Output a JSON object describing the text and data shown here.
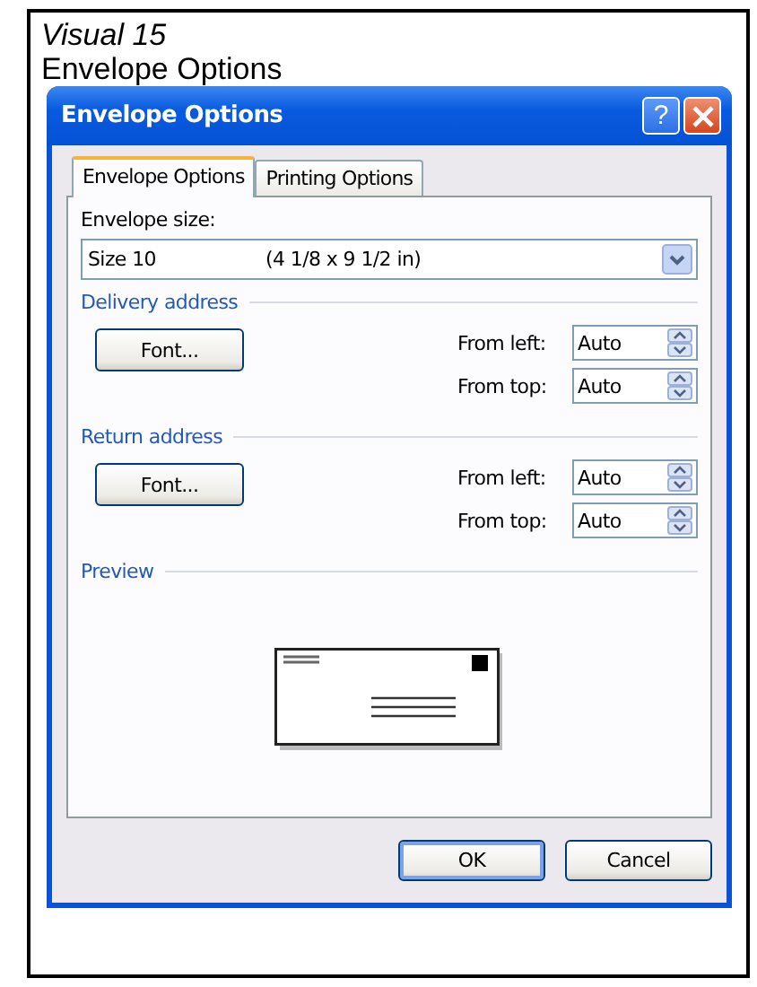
{
  "heading": {
    "caption": "Visual 15",
    "title": "Envelope Options"
  },
  "window": {
    "title": "Envelope Options",
    "help": "?"
  },
  "tabs": [
    {
      "label": "Envelope Options",
      "selected": true
    },
    {
      "label": "Printing Options",
      "selected": false
    }
  ],
  "envelope_size": {
    "label": "Envelope size:",
    "value": "Size 10",
    "dimensions": "(4 1/8 x 9 1/2 in)"
  },
  "sections": [
    {
      "title": "Delivery address",
      "button": "Font...",
      "fields": [
        {
          "label": "From left:",
          "value": "Auto"
        },
        {
          "label": "From top:",
          "value": "Auto"
        }
      ]
    },
    {
      "title": "Return address",
      "button": "Font...",
      "fields": [
        {
          "label": "From left:",
          "value": "Auto"
        },
        {
          "label": "From top:",
          "value": "Auto"
        }
      ]
    }
  ],
  "preview": {
    "title": "Preview"
  },
  "buttons": [
    {
      "label": "OK",
      "default": true
    },
    {
      "label": "Cancel",
      "default": false
    }
  ]
}
